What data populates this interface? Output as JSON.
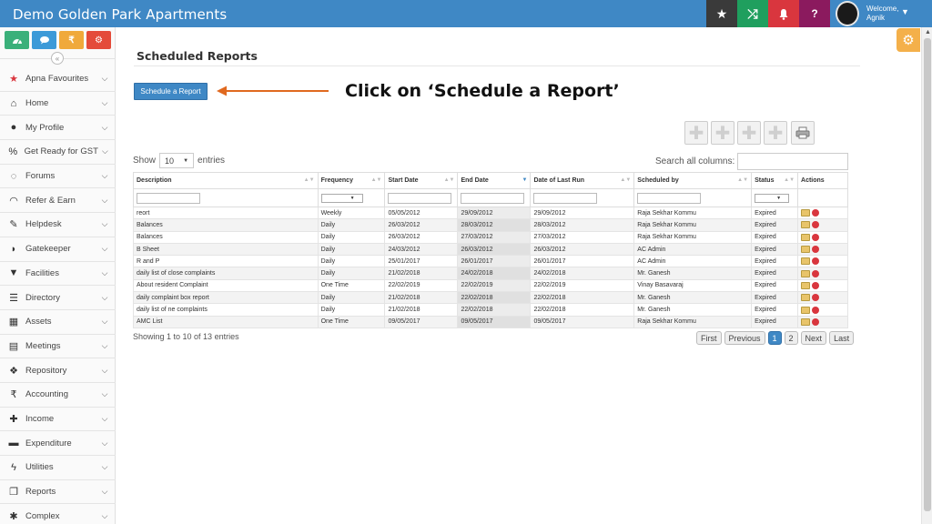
{
  "header": {
    "brand": "Demo Golden Park Apartments",
    "welcome": "Welcome,",
    "user": "Agnik",
    "icons": [
      "star-icon",
      "shuffle-icon",
      "bell-icon",
      "help-icon"
    ],
    "colors": {
      "bar": "#3f88c5",
      "star": "#3a3a3a",
      "shuffle": "#1f9f5e",
      "bell": "#d9363e",
      "help": "#8b1a5e"
    }
  },
  "sidebar": {
    "quick_buttons": [
      "dashboard-icon",
      "chat-icon",
      "rupee-icon",
      "settings-icon"
    ],
    "rupee_symbol": "₹",
    "collapse_symbol": "«",
    "items": [
      {
        "label": "Apna Favourites",
        "icon": "star-icon"
      },
      {
        "label": "Home",
        "icon": "home-icon"
      },
      {
        "label": "My Profile",
        "icon": "user-icon"
      },
      {
        "label": "Get Ready for GST",
        "icon": "percent-icon"
      },
      {
        "label": "Forums",
        "icon": "forum-icon"
      },
      {
        "label": "Refer & Earn",
        "icon": "handshake-icon"
      },
      {
        "label": "Helpdesk",
        "icon": "wrench-icon"
      },
      {
        "label": "Gatekeeper",
        "icon": "shield-icon"
      },
      {
        "label": "Facilities",
        "icon": "filter-icon"
      },
      {
        "label": "Directory",
        "icon": "list-icon"
      },
      {
        "label": "Assets",
        "icon": "building-icon"
      },
      {
        "label": "Meetings",
        "icon": "calendar-icon"
      },
      {
        "label": "Repository",
        "icon": "dropbox-icon"
      },
      {
        "label": "Accounting",
        "icon": "rupee-icon"
      },
      {
        "label": "Income",
        "icon": "plus-icon"
      },
      {
        "label": "Expenditure",
        "icon": "minus-icon"
      },
      {
        "label": "Utilities",
        "icon": "bolt-icon"
      },
      {
        "label": "Reports",
        "icon": "copy-icon"
      },
      {
        "label": "Complex",
        "icon": "cog-icon"
      }
    ]
  },
  "main": {
    "page_title": "Scheduled Reports",
    "schedule_button": "Schedule a Report",
    "callout": "Click on ‘Schedule a Report’",
    "show_label": "Show",
    "entries_value": "10",
    "entries_label": "entries",
    "search_label": "Search all columns:",
    "columns": [
      "Description",
      "Frequency",
      "Start Date",
      "End Date",
      "Date of Last Run",
      "Scheduled by",
      "Status",
      "Actions"
    ],
    "rows": [
      [
        "reort",
        "Weekly",
        "05/05/2012",
        "29/09/2012",
        "29/09/2012",
        "Raja Sekhar Kommu",
        "Expired"
      ],
      [
        "Balances",
        "Daily",
        "26/03/2012",
        "28/03/2012",
        "28/03/2012",
        "Raja Sekhar Kommu",
        "Expired"
      ],
      [
        "Balances",
        "Daily",
        "26/03/2012",
        "27/03/2012",
        "27/03/2012",
        "Raja Sekhar Kommu",
        "Expired"
      ],
      [
        "B Sheet",
        "Daily",
        "24/03/2012",
        "26/03/2012",
        "26/03/2012",
        "AC Admin",
        "Expired"
      ],
      [
        "R and P",
        "Daily",
        "25/01/2017",
        "26/01/2017",
        "26/01/2017",
        "AC Admin",
        "Expired"
      ],
      [
        "daily list of close complaints",
        "Daily",
        "21/02/2018",
        "24/02/2018",
        "24/02/2018",
        "Mr. Ganesh",
        "Expired"
      ],
      [
        "About resident Complaint",
        "One Time",
        "22/02/2019",
        "22/02/2019",
        "22/02/2019",
        "Vinay Basavaraj",
        "Expired"
      ],
      [
        "daily complaint box report",
        "Daily",
        "21/02/2018",
        "22/02/2018",
        "22/02/2018",
        "Mr. Ganesh",
        "Expired"
      ],
      [
        "daily list of ne complaints",
        "Daily",
        "21/02/2018",
        "22/02/2018",
        "22/02/2018",
        "Mr. Ganesh",
        "Expired"
      ],
      [
        "AMC List",
        "One Time",
        "09/05/2017",
        "09/05/2017",
        "09/05/2017",
        "Raja Sekhar Kommu",
        "Expired"
      ]
    ],
    "info": "Showing 1 to 10 of 13 entries",
    "pager": {
      "first": "First",
      "previous": "Previous",
      "pages": [
        "1",
        "2"
      ],
      "next": "Next",
      "last": "Last"
    }
  }
}
